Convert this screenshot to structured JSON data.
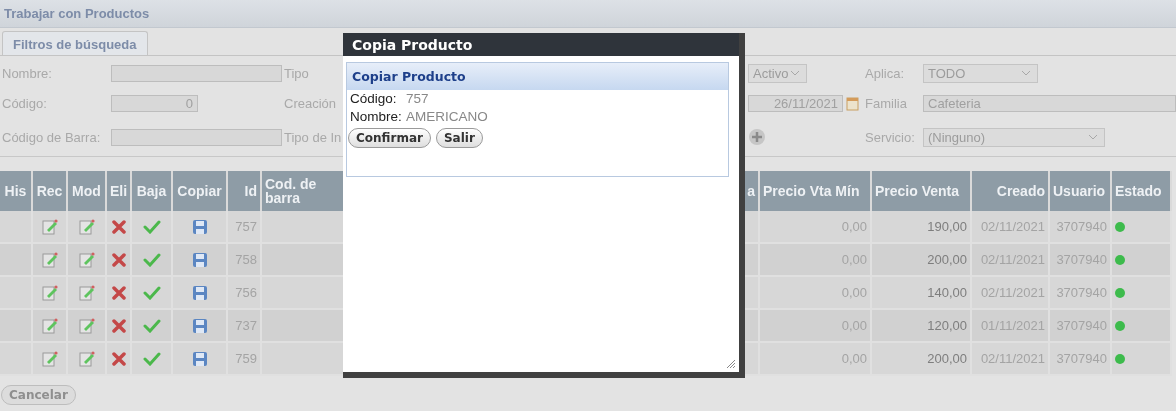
{
  "header": {
    "title": "Trabajar con Productos"
  },
  "tabs": [
    {
      "label": "Filtros de búsqueda",
      "selected": true
    }
  ],
  "filters": {
    "nombre": {
      "label": "Nombre:"
    },
    "tipo": {
      "label": "Tipo",
      "value": "Activo"
    },
    "aplica": {
      "label": "Aplica:",
      "value": "TODO"
    },
    "codigo": {
      "label": "Código:",
      "value": "0"
    },
    "creacion": {
      "label": "Creación",
      "value": "26/11/2021"
    },
    "familia": {
      "label": "Familia",
      "value": "Cafeteria"
    },
    "codigo_barra": {
      "label": "Código de Barra:"
    },
    "tipo_in": {
      "label": "Tipo de In"
    },
    "servicio": {
      "label": "Servicio:",
      "value": "(Ninguno)"
    }
  },
  "table": {
    "columns": [
      "His",
      "Rec",
      "Mod",
      "Eli",
      "Baja",
      "Copiar",
      "Id",
      "Cod. de barra",
      "a",
      "Precio Vta Mín",
      "Precio Venta",
      "Creado",
      "Usuario",
      "Estado"
    ],
    "rows": [
      {
        "id": "757",
        "precio_vta_min": "0,00",
        "precio_venta": "190,00",
        "creado": "02/11/2021",
        "usuario": "3707940",
        "color": "#3dbb4c"
      },
      {
        "id": "758",
        "precio_vta_min": "0,00",
        "precio_venta": "200,00",
        "creado": "02/11/2021",
        "usuario": "3707940",
        "color": "#3dbb4c"
      },
      {
        "id": "756",
        "precio_vta_min": "0,00",
        "precio_venta": "140,00",
        "creado": "02/11/2021",
        "usuario": "3707940",
        "color": "#3dbb4c"
      },
      {
        "id": "737",
        "precio_vta_min": "0,00",
        "precio_venta": "120,00",
        "creado": "01/11/2021",
        "usuario": "3707940",
        "color": "#3dbb4c"
      },
      {
        "id": "759",
        "precio_vta_min": "0,00",
        "precio_venta": "200,00",
        "creado": "02/11/2021",
        "usuario": "3707940",
        "color": "#3dbb4c"
      }
    ]
  },
  "buttons": [
    {
      "label": "Cancelar"
    }
  ],
  "dialog": {
    "title": "Copia Producto",
    "panel_title": "Copiar Producto",
    "fields": [
      {
        "label": "Código:",
        "value": "757"
      },
      {
        "label": "Nombre:",
        "value": "AMERICANO"
      }
    ],
    "buttons": [
      {
        "label": "Confirmar"
      },
      {
        "label": "Salir"
      }
    ]
  }
}
